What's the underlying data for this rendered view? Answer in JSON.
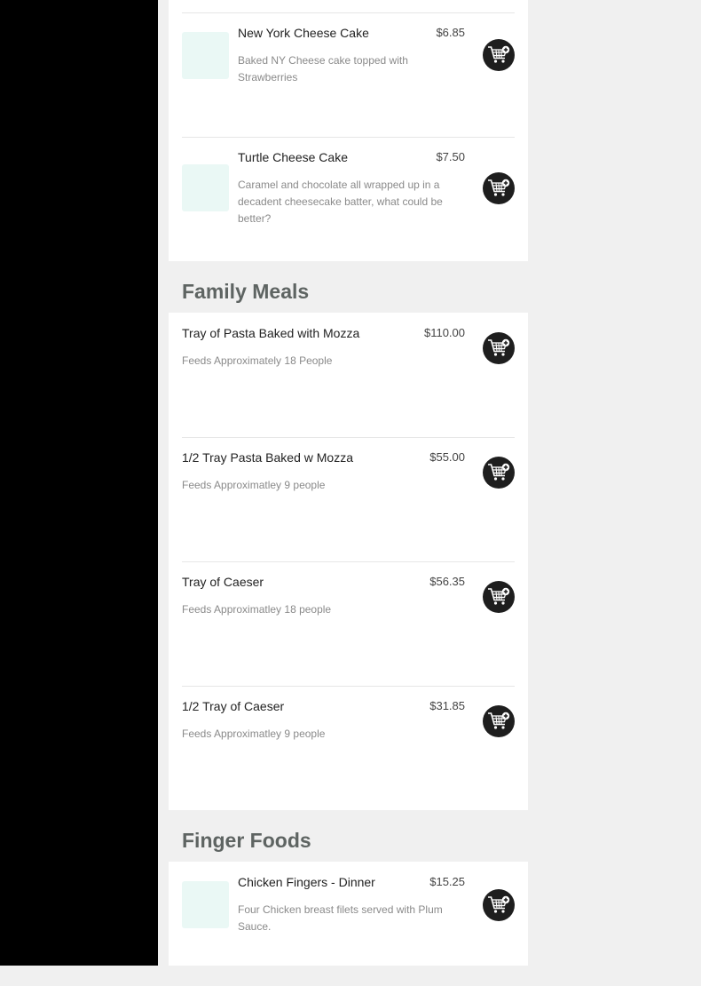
{
  "colors": {
    "sidebar": "#000000",
    "page_background": "#f0f0f0",
    "card_background": "#ffffff",
    "category_heading": "#5e6462",
    "thumbnail_placeholder": "#eaf8f5",
    "cart_button": "#1e1e1e"
  },
  "icons": {
    "add_to_cart": "cart-plus-icon"
  },
  "categories": [
    {
      "title": "",
      "items": [
        {
          "name": "New York Cheese Cake",
          "price": "$6.85",
          "description": "Baked NY Cheese cake topped with Strawberries"
        },
        {
          "name": "Turtle Cheese Cake",
          "price": "$7.50",
          "description": "Caramel and chocolate all wrapped up in a decadent cheesecake batter, what could be better?"
        }
      ]
    },
    {
      "title": "Family Meals",
      "items": [
        {
          "name": "Tray of Pasta Baked with Mozza",
          "price": "$110.00",
          "description": "Feeds Approximately 18 People"
        },
        {
          "name": "1/2 Tray Pasta Baked w Mozza",
          "price": "$55.00",
          "description": "Feeds Approximatley 9 people"
        },
        {
          "name": "Tray of Caeser",
          "price": "$56.35",
          "description": "Feeds Approximatley 18 people"
        },
        {
          "name": "1/2 Tray of Caeser",
          "price": "$31.85",
          "description": "Feeds Approximatley 9 people"
        }
      ]
    },
    {
      "title": "Finger Foods",
      "items": [
        {
          "name": "Chicken Fingers - Dinner",
          "price": "$15.25",
          "description": "Four Chicken breast filets served with Plum Sauce."
        }
      ]
    }
  ]
}
